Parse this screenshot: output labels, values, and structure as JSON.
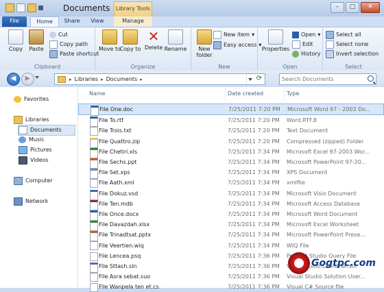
{
  "window": {
    "title": "Documents",
    "context_tab": "Library Tools",
    "buttons": [
      "–",
      "□",
      "✕"
    ]
  },
  "tabs": [
    "File",
    "Home",
    "Share",
    "View",
    "Manage"
  ],
  "ribbon": {
    "clipboard": {
      "label": "Clipboard",
      "copy": "Copy",
      "paste": "Paste",
      "cut": "Cut",
      "copy_path": "Copy path",
      "paste_shortcut": "Paste shortcut"
    },
    "organize": {
      "label": "Organize",
      "move_to": "Move to",
      "copy_to": "Copy to",
      "delete": "Delete",
      "rename": "Rename"
    },
    "new": {
      "label": "New",
      "new_folder": "New folder",
      "new_item": "New item",
      "easy_access": "Easy access"
    },
    "open": {
      "label": "Open",
      "properties": "Properties",
      "open": "Open",
      "edit": "Edit",
      "history": "History"
    },
    "select": {
      "label": "Select",
      "select_all": "Select all",
      "select_none": "Select none",
      "invert_selection": "Invert selection"
    }
  },
  "address": {
    "crumbs": [
      "Libraries",
      "Documents"
    ],
    "search_placeholder": "Search Documents"
  },
  "nav": {
    "favorites": "Favorites",
    "libraries": "Libraries",
    "documents": "Documents",
    "music": "Music",
    "pictures": "Pictures",
    "videos": "Videos",
    "computer": "Computer",
    "network": "Network"
  },
  "columns": {
    "name": "Name",
    "date": "Date created",
    "type": "Type"
  },
  "files": [
    {
      "name": "File One.doc",
      "date": "7/25/2011 7:20 PM",
      "type": "Microsoft Word 97 - 2003 Do..."
    },
    {
      "name": "File To.rtf",
      "date": "7/25/2011 7:20 PM",
      "type": "Word.RTF.8"
    },
    {
      "name": "File Trois.txt",
      "date": "7/25/2011 7:20 PM",
      "type": "Text Document"
    },
    {
      "name": "File Quattro.zip",
      "date": "7/25/2011 7:20 PM",
      "type": "Compressed (zipped) Folder"
    },
    {
      "name": "File Chetiri.xls",
      "date": "7/25/2011 7:34 PM",
      "type": "Microsoft Excel 97-2003 Wor..."
    },
    {
      "name": "File Sechs.ppt",
      "date": "7/25/2011 7:34 PM",
      "type": "Microsoft PowerPoint 97-20..."
    },
    {
      "name": "File Set.xps",
      "date": "7/25/2011 7:34 PM",
      "type": "XPS Document"
    },
    {
      "name": "File Aath.xml",
      "date": "7/25/2011 7:34 PM",
      "type": "xmlfile"
    },
    {
      "name": "File Dokuz.vsd",
      "date": "7/25/2011 7:34 PM",
      "type": "Microsoft Visio Document"
    },
    {
      "name": "File Ten.mdb",
      "date": "7/25/2011 7:34 PM",
      "type": "Microsoft Access Database"
    },
    {
      "name": "File Once.docx",
      "date": "7/25/2011 7:34 PM",
      "type": "Microsoft Word Document"
    },
    {
      "name": "File Davazdah.xlsx",
      "date": "7/25/2011 7:34 PM",
      "type": "Microsoft Excel Worksheet"
    },
    {
      "name": "File Trinadtsat.pptx",
      "date": "7/25/2011 7:34 PM",
      "type": "Microsoft PowerPoint Prese..."
    },
    {
      "name": "File Veertien.wiq",
      "date": "7/25/2011 7:34 PM",
      "type": "WIQ File"
    },
    {
      "name": "File Lencea.psq",
      "date": "7/25/2011 7:36 PM",
      "type": "Product Studio Query File"
    },
    {
      "name": "File Sttash.sln",
      "date": "7/25/2011 7:36 PM",
      "type": "VisualStudio.Launcher.sln"
    },
    {
      "name": "File Asra sebat.suo",
      "date": "7/25/2011 7:36 PM",
      "type": "Visual Studio Solution User..."
    },
    {
      "name": "File Wanpela ten et.cs",
      "date": "7/25/2011 7:36 PM",
      "type": "Visual C# Source file"
    }
  ],
  "watermark": "Gogtpc.com",
  "colors": {
    "accent": "#1b56a8",
    "selection": "#d7e6f8",
    "context_tab": "#f0cf85"
  }
}
